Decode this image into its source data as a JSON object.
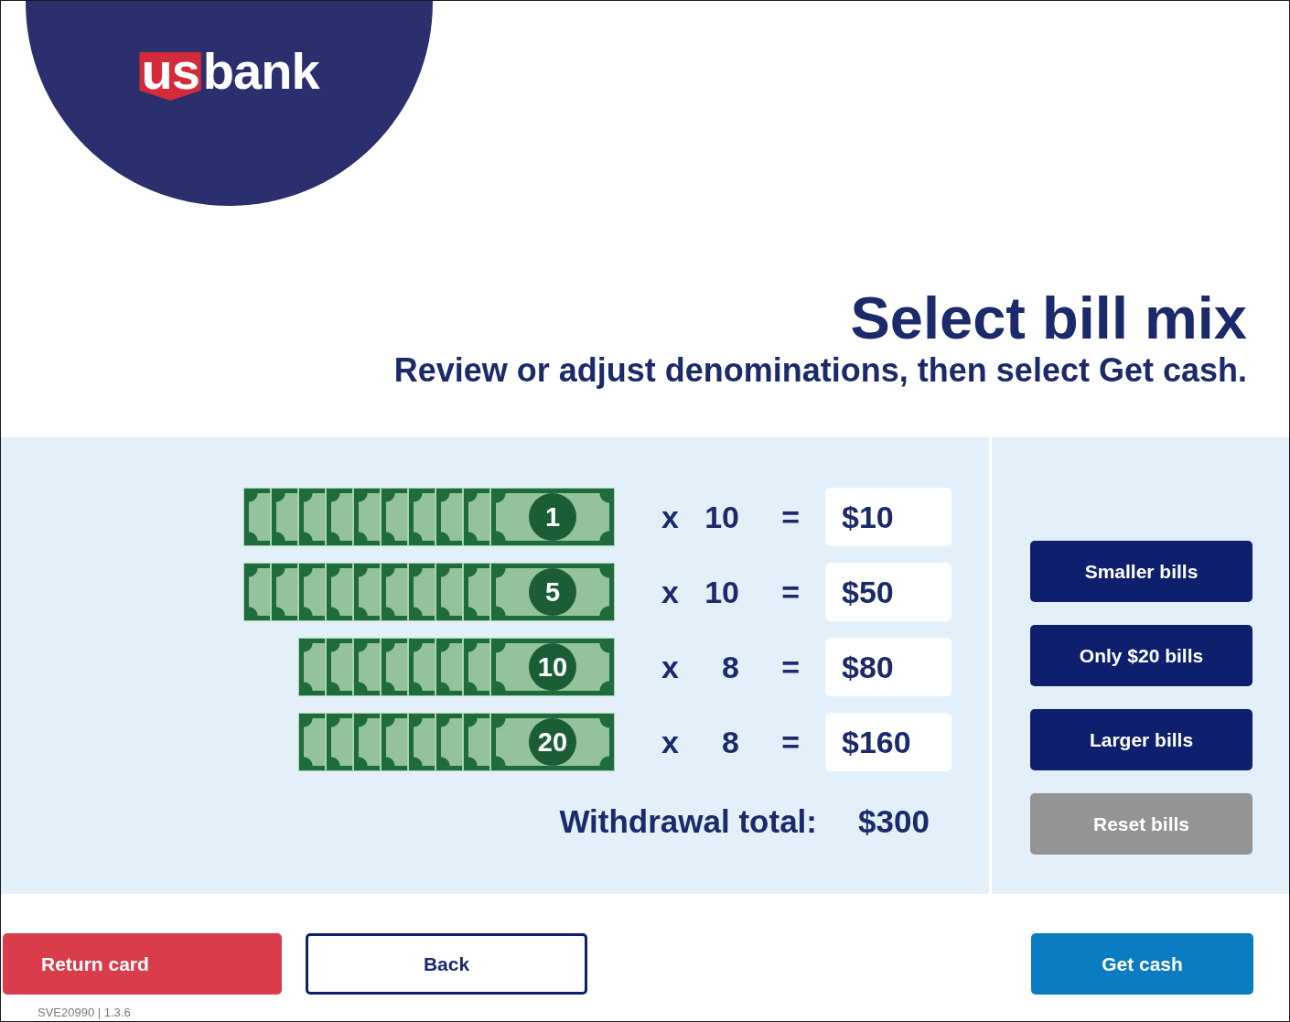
{
  "logo": {
    "mark": "us",
    "wordmark": "bank"
  },
  "title": "Select bill mix",
  "subtitle": "Review or adjust denominations, then select Get cash.",
  "bill_rows": [
    {
      "denomination": "1",
      "multiplier": "x",
      "count": "10",
      "equals": "=",
      "amount": "$10"
    },
    {
      "denomination": "5",
      "multiplier": "x",
      "count": "10",
      "equals": "=",
      "amount": "$50"
    },
    {
      "denomination": "10",
      "multiplier": "x",
      "count": "8",
      "equals": "=",
      "amount": "$80"
    },
    {
      "denomination": "20",
      "multiplier": "x",
      "count": "8",
      "equals": "=",
      "amount": "$160"
    }
  ],
  "total": {
    "label": "Withdrawal total:",
    "amount": "$300"
  },
  "mix_buttons": [
    {
      "label": "Smaller bills",
      "disabled": false
    },
    {
      "label": "Only $20 bills",
      "disabled": false
    },
    {
      "label": "Larger bills",
      "disabled": false
    },
    {
      "label": "Reset bills",
      "disabled": true
    }
  ],
  "footer": {
    "buttons": [
      {
        "label": "Return card",
        "kind": "danger"
      },
      {
        "label": "Back",
        "kind": "outline"
      },
      {
        "label": "Get cash",
        "kind": "primary"
      }
    ],
    "version": "SVE20990 | 1.3.6"
  }
}
